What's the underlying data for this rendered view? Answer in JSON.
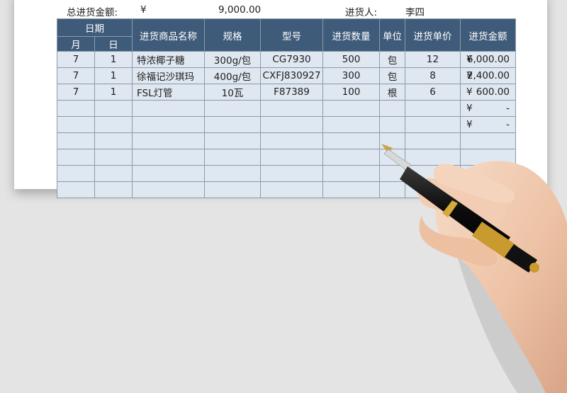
{
  "summary": {
    "total_label": "总进货金额:",
    "currency": "¥",
    "total_value": "9,000.00",
    "purchaser_label": "进货人:",
    "purchaser": "李四"
  },
  "table": {
    "headers": {
      "date": "日期",
      "month": "月",
      "day": "日",
      "name": "进货商品名称",
      "spec": "规格",
      "model": "型号",
      "qty": "进货数量",
      "unit": "单位",
      "price": "进货单价",
      "amount": "进货金额"
    },
    "rows": [
      {
        "month": "7",
        "day": "1",
        "name": "特浓椰子糖",
        "spec": "300g/包",
        "model": "CG7930",
        "qty": "500",
        "unit": "包",
        "price": "12",
        "yen": "¥",
        "amount": "6,000.00"
      },
      {
        "month": "7",
        "day": "1",
        "name": "徐福记沙琪玛",
        "spec": "400g/包",
        "model": "CXFJ830927",
        "qty": "300",
        "unit": "包",
        "price": "8",
        "yen": "¥",
        "amount": "2,400.00"
      },
      {
        "month": "7",
        "day": "1",
        "name": "FSL灯管",
        "spec": "10瓦",
        "model": "F87389",
        "qty": "100",
        "unit": "根",
        "price": "6",
        "yen": "¥",
        "amount": "600.00"
      },
      {
        "month": "",
        "day": "",
        "name": "",
        "spec": "",
        "model": "",
        "qty": "",
        "unit": "",
        "price": "",
        "yen": "¥",
        "amount": "-"
      },
      {
        "month": "",
        "day": "",
        "name": "",
        "spec": "",
        "model": "",
        "qty": "",
        "unit": "",
        "price": "",
        "yen": "¥",
        "amount": "-"
      },
      {
        "month": "",
        "day": "",
        "name": "",
        "spec": "",
        "model": "",
        "qty": "",
        "unit": "",
        "price": "",
        "yen": "",
        "amount": ""
      },
      {
        "month": "",
        "day": "",
        "name": "",
        "spec": "",
        "model": "",
        "qty": "",
        "unit": "",
        "price": "",
        "yen": "",
        "amount": ""
      },
      {
        "month": "",
        "day": "",
        "name": "",
        "spec": "",
        "model": "",
        "qty": "",
        "unit": "",
        "price": "",
        "yen": "",
        "amount": ""
      },
      {
        "month": "",
        "day": "",
        "name": "",
        "spec": "",
        "model": "",
        "qty": "",
        "unit": "",
        "price": "",
        "yen": "",
        "amount": ""
      }
    ]
  },
  "colors": {
    "header_bg": "#3f5b7a",
    "cell_bg": "#dfe7f1",
    "grid_line": "#8b9aab",
    "background": "#e4e4e4"
  },
  "decor": {
    "image": "hand-holding-fountain-pen"
  }
}
